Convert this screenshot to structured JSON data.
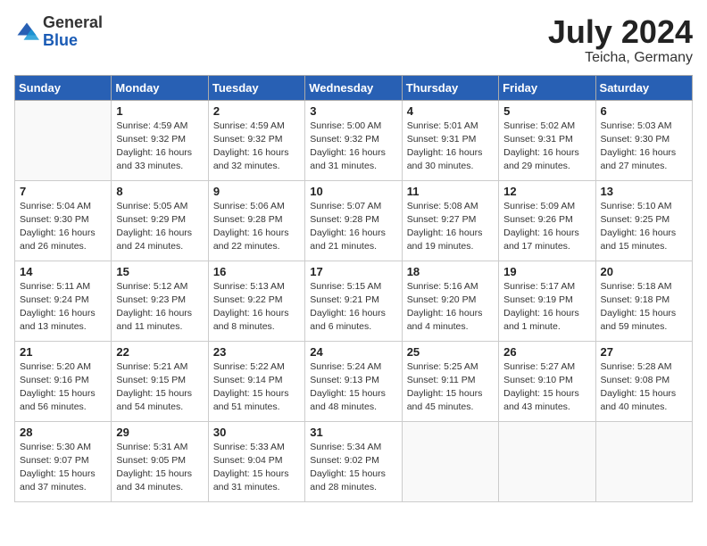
{
  "logo": {
    "general": "General",
    "blue": "Blue"
  },
  "title": "July 2024",
  "location": "Teicha, Germany",
  "days_of_week": [
    "Sunday",
    "Monday",
    "Tuesday",
    "Wednesday",
    "Thursday",
    "Friday",
    "Saturday"
  ],
  "weeks": [
    [
      {
        "day": "",
        "info": ""
      },
      {
        "day": "1",
        "info": "Sunrise: 4:59 AM\nSunset: 9:32 PM\nDaylight: 16 hours\nand 33 minutes."
      },
      {
        "day": "2",
        "info": "Sunrise: 4:59 AM\nSunset: 9:32 PM\nDaylight: 16 hours\nand 32 minutes."
      },
      {
        "day": "3",
        "info": "Sunrise: 5:00 AM\nSunset: 9:32 PM\nDaylight: 16 hours\nand 31 minutes."
      },
      {
        "day": "4",
        "info": "Sunrise: 5:01 AM\nSunset: 9:31 PM\nDaylight: 16 hours\nand 30 minutes."
      },
      {
        "day": "5",
        "info": "Sunrise: 5:02 AM\nSunset: 9:31 PM\nDaylight: 16 hours\nand 29 minutes."
      },
      {
        "day": "6",
        "info": "Sunrise: 5:03 AM\nSunset: 9:30 PM\nDaylight: 16 hours\nand 27 minutes."
      }
    ],
    [
      {
        "day": "7",
        "info": "Sunrise: 5:04 AM\nSunset: 9:30 PM\nDaylight: 16 hours\nand 26 minutes."
      },
      {
        "day": "8",
        "info": "Sunrise: 5:05 AM\nSunset: 9:29 PM\nDaylight: 16 hours\nand 24 minutes."
      },
      {
        "day": "9",
        "info": "Sunrise: 5:06 AM\nSunset: 9:28 PM\nDaylight: 16 hours\nand 22 minutes."
      },
      {
        "day": "10",
        "info": "Sunrise: 5:07 AM\nSunset: 9:28 PM\nDaylight: 16 hours\nand 21 minutes."
      },
      {
        "day": "11",
        "info": "Sunrise: 5:08 AM\nSunset: 9:27 PM\nDaylight: 16 hours\nand 19 minutes."
      },
      {
        "day": "12",
        "info": "Sunrise: 5:09 AM\nSunset: 9:26 PM\nDaylight: 16 hours\nand 17 minutes."
      },
      {
        "day": "13",
        "info": "Sunrise: 5:10 AM\nSunset: 9:25 PM\nDaylight: 16 hours\nand 15 minutes."
      }
    ],
    [
      {
        "day": "14",
        "info": "Sunrise: 5:11 AM\nSunset: 9:24 PM\nDaylight: 16 hours\nand 13 minutes."
      },
      {
        "day": "15",
        "info": "Sunrise: 5:12 AM\nSunset: 9:23 PM\nDaylight: 16 hours\nand 11 minutes."
      },
      {
        "day": "16",
        "info": "Sunrise: 5:13 AM\nSunset: 9:22 PM\nDaylight: 16 hours\nand 8 minutes."
      },
      {
        "day": "17",
        "info": "Sunrise: 5:15 AM\nSunset: 9:21 PM\nDaylight: 16 hours\nand 6 minutes."
      },
      {
        "day": "18",
        "info": "Sunrise: 5:16 AM\nSunset: 9:20 PM\nDaylight: 16 hours\nand 4 minutes."
      },
      {
        "day": "19",
        "info": "Sunrise: 5:17 AM\nSunset: 9:19 PM\nDaylight: 16 hours\nand 1 minute."
      },
      {
        "day": "20",
        "info": "Sunrise: 5:18 AM\nSunset: 9:18 PM\nDaylight: 15 hours\nand 59 minutes."
      }
    ],
    [
      {
        "day": "21",
        "info": "Sunrise: 5:20 AM\nSunset: 9:16 PM\nDaylight: 15 hours\nand 56 minutes."
      },
      {
        "day": "22",
        "info": "Sunrise: 5:21 AM\nSunset: 9:15 PM\nDaylight: 15 hours\nand 54 minutes."
      },
      {
        "day": "23",
        "info": "Sunrise: 5:22 AM\nSunset: 9:14 PM\nDaylight: 15 hours\nand 51 minutes."
      },
      {
        "day": "24",
        "info": "Sunrise: 5:24 AM\nSunset: 9:13 PM\nDaylight: 15 hours\nand 48 minutes."
      },
      {
        "day": "25",
        "info": "Sunrise: 5:25 AM\nSunset: 9:11 PM\nDaylight: 15 hours\nand 45 minutes."
      },
      {
        "day": "26",
        "info": "Sunrise: 5:27 AM\nSunset: 9:10 PM\nDaylight: 15 hours\nand 43 minutes."
      },
      {
        "day": "27",
        "info": "Sunrise: 5:28 AM\nSunset: 9:08 PM\nDaylight: 15 hours\nand 40 minutes."
      }
    ],
    [
      {
        "day": "28",
        "info": "Sunrise: 5:30 AM\nSunset: 9:07 PM\nDaylight: 15 hours\nand 37 minutes."
      },
      {
        "day": "29",
        "info": "Sunrise: 5:31 AM\nSunset: 9:05 PM\nDaylight: 15 hours\nand 34 minutes."
      },
      {
        "day": "30",
        "info": "Sunrise: 5:33 AM\nSunset: 9:04 PM\nDaylight: 15 hours\nand 31 minutes."
      },
      {
        "day": "31",
        "info": "Sunrise: 5:34 AM\nSunset: 9:02 PM\nDaylight: 15 hours\nand 28 minutes."
      },
      {
        "day": "",
        "info": ""
      },
      {
        "day": "",
        "info": ""
      },
      {
        "day": "",
        "info": ""
      }
    ]
  ]
}
